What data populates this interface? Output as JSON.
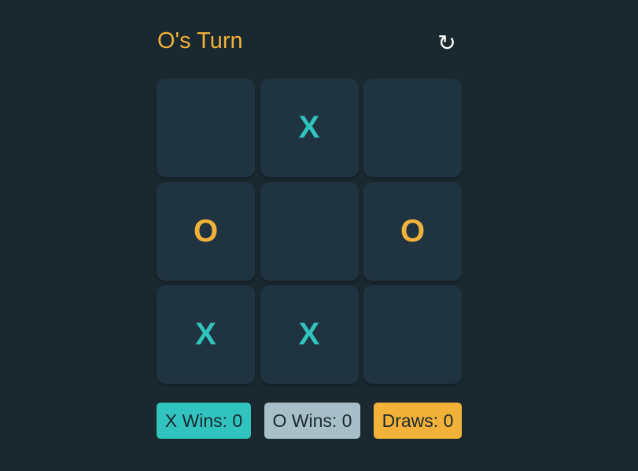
{
  "header": {
    "turn_text": "O's Turn",
    "reset_icon": "↻"
  },
  "board": {
    "cells": [
      "",
      "X",
      "",
      "O",
      "",
      "O",
      "X",
      "X",
      ""
    ]
  },
  "scores": {
    "x_wins": "X Wins: 0",
    "o_wins": "O Wins: 0",
    "draws": "Draws: 0"
  },
  "colors": {
    "background": "#1a2830",
    "cell": "#1f3440",
    "x_accent": "#31c3bd",
    "o_accent": "#f2b138",
    "draw_badge": "#a8bfc9"
  }
}
